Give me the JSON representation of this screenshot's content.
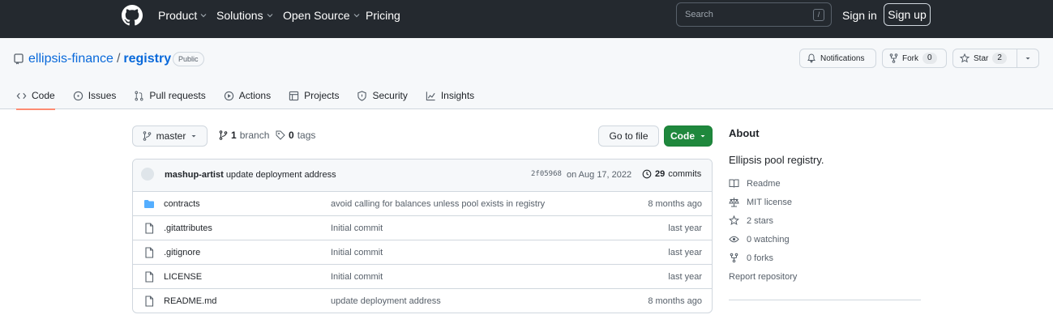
{
  "header": {
    "nav": [
      {
        "label": "Product",
        "dropdown": true
      },
      {
        "label": "Solutions",
        "dropdown": true
      },
      {
        "label": "Open Source",
        "dropdown": true
      },
      {
        "label": "Pricing",
        "dropdown": false
      }
    ],
    "search_placeholder": "Search",
    "search_shortcut": "/",
    "sign_in": "Sign in",
    "sign_up": "Sign up"
  },
  "repo": {
    "owner": "ellipsis-finance",
    "separator": "/",
    "name": "registry",
    "visibility": "Public",
    "notifications_label": "Notifications",
    "fork_label": "Fork",
    "fork_count": "0",
    "star_label": "Star",
    "star_count": "2"
  },
  "tabs": [
    {
      "label": "Code",
      "icon": "code-icon",
      "active": true
    },
    {
      "label": "Issues",
      "icon": "issue-icon"
    },
    {
      "label": "Pull requests",
      "icon": "pull-request-icon"
    },
    {
      "label": "Actions",
      "icon": "play-icon"
    },
    {
      "label": "Projects",
      "icon": "table-icon"
    },
    {
      "label": "Security",
      "icon": "shield-icon"
    },
    {
      "label": "Insights",
      "icon": "graph-icon"
    }
  ],
  "toolbar": {
    "branch": "master",
    "branch_count": "1",
    "branch_label": "branch",
    "tag_count": "0",
    "tag_label": "tags",
    "go_to_file": "Go to file",
    "code": "Code"
  },
  "commit": {
    "author": "mashup-artist",
    "message": "update deployment address",
    "sha": "2f05968",
    "date": "on Aug 17, 2022",
    "count": "29",
    "count_label": "commits"
  },
  "files": [
    {
      "name": "contracts",
      "type": "folder",
      "message": "avoid calling for balances unless pool exists in registry",
      "age": "8 months ago"
    },
    {
      "name": ".gitattributes",
      "type": "file",
      "message": "Initial commit",
      "age": "last year"
    },
    {
      "name": ".gitignore",
      "type": "file",
      "message": "Initial commit",
      "age": "last year"
    },
    {
      "name": "LICENSE",
      "type": "file",
      "message": "Initial commit",
      "age": "last year"
    },
    {
      "name": "README.md",
      "type": "file",
      "message": "update deployment address",
      "age": "8 months ago"
    }
  ],
  "about": {
    "title": "About",
    "description": "Ellipsis pool registry.",
    "readme": "Readme",
    "license": "MIT license",
    "stars": "2 stars",
    "watching": "0 watching",
    "forks": "0 forks",
    "report": "Report repository"
  },
  "colors": {
    "header_bg": "#24292f",
    "link": "#0969da",
    "code_button": "#1f883d",
    "active_tab_underline": "#fd8c73",
    "folder": "#54aeff"
  }
}
